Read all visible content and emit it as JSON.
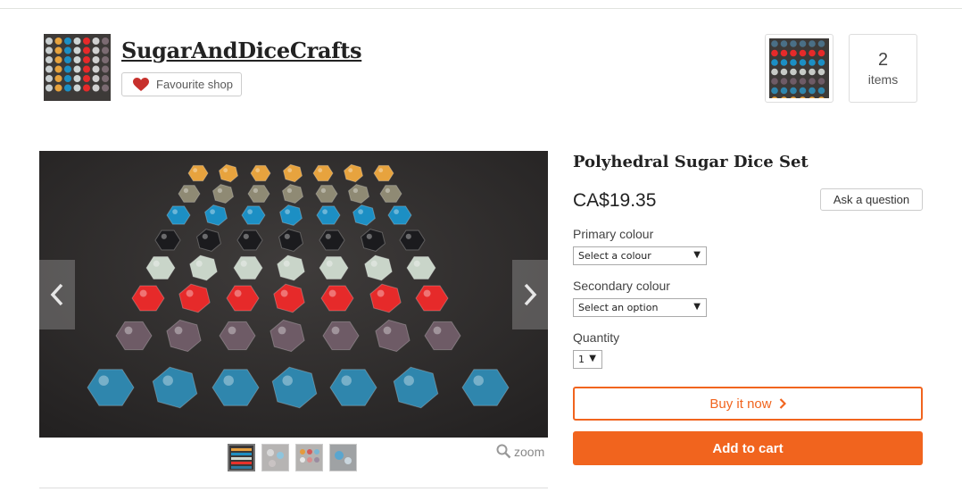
{
  "shop": {
    "name": "SugarAndDiceCrafts",
    "favourite_label": "Favourite shop"
  },
  "cart": {
    "count": "2",
    "label": "items"
  },
  "gallery": {
    "zoom_label": "zoom",
    "thumbnail_count": 4
  },
  "product": {
    "title": "Polyhedral Sugar Dice Set",
    "price": "CA$19.35",
    "ask_label": "Ask a question"
  },
  "options": {
    "primary": {
      "label": "Primary colour",
      "selected": "Select a colour"
    },
    "secondary": {
      "label": "Secondary colour",
      "selected": "Select an option"
    },
    "quantity": {
      "label": "Quantity",
      "selected": "1"
    }
  },
  "actions": {
    "buy_now": "Buy it now",
    "add_to_cart": "Add to cart"
  },
  "colors": {
    "accent": "#f1641e",
    "heart": "#c7302c",
    "photo_background": "#343232"
  },
  "icons": {
    "favourite": "heart-icon",
    "prev": "chevron-left-icon",
    "next": "chevron-right-icon",
    "buy": "chevron-right-icon",
    "zoom": "magnifier-icon",
    "select": "caret-down-icon"
  }
}
